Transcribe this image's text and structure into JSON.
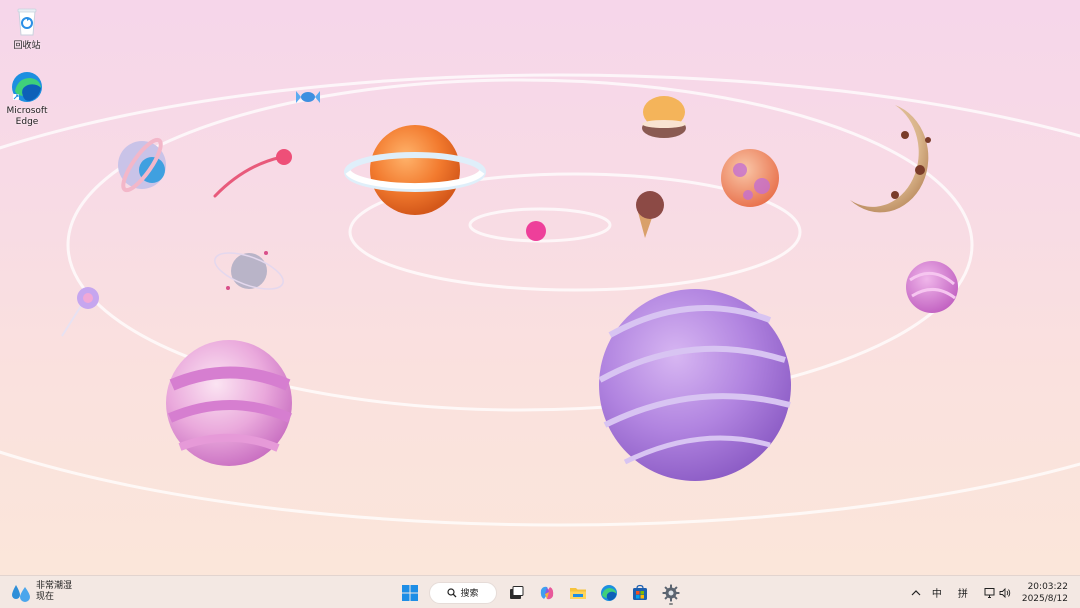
{
  "desktop": {
    "icons": [
      {
        "label": "回收站",
        "icon": "recycle-bin-icon"
      },
      {
        "label": "Microsoft Edge",
        "icon": "edge-icon"
      }
    ]
  },
  "taskbar": {
    "weather": {
      "condition": "非常潮湿",
      "time": "现在",
      "icon": "water-drops-icon"
    },
    "start_icon": "windows-start-icon",
    "search_label": "搜索",
    "apps": [
      {
        "name": "task-view",
        "icon": "task-view-icon"
      },
      {
        "name": "copilot",
        "icon": "copilot-icon"
      },
      {
        "name": "file-explorer",
        "icon": "folder-icon"
      },
      {
        "name": "edge",
        "icon": "edge-icon"
      },
      {
        "name": "store",
        "icon": "store-icon"
      },
      {
        "name": "settings",
        "icon": "gear-icon",
        "active": true
      }
    ],
    "tray": {
      "overflow_icon": "chevron-up-icon",
      "ime_lang": "中",
      "ime_mode": "拼",
      "network_icon": "network-icon",
      "volume_icon": "volume-icon"
    },
    "clock": {
      "time": "20:03:22",
      "date": "2025/8/12"
    }
  },
  "colors": {
    "wallpaper_top": "#f6d6ea",
    "wallpaper_bottom": "#fbe6da",
    "taskbar_bg": "#f3e8e3",
    "windows_blue": "#1e8ee6"
  }
}
